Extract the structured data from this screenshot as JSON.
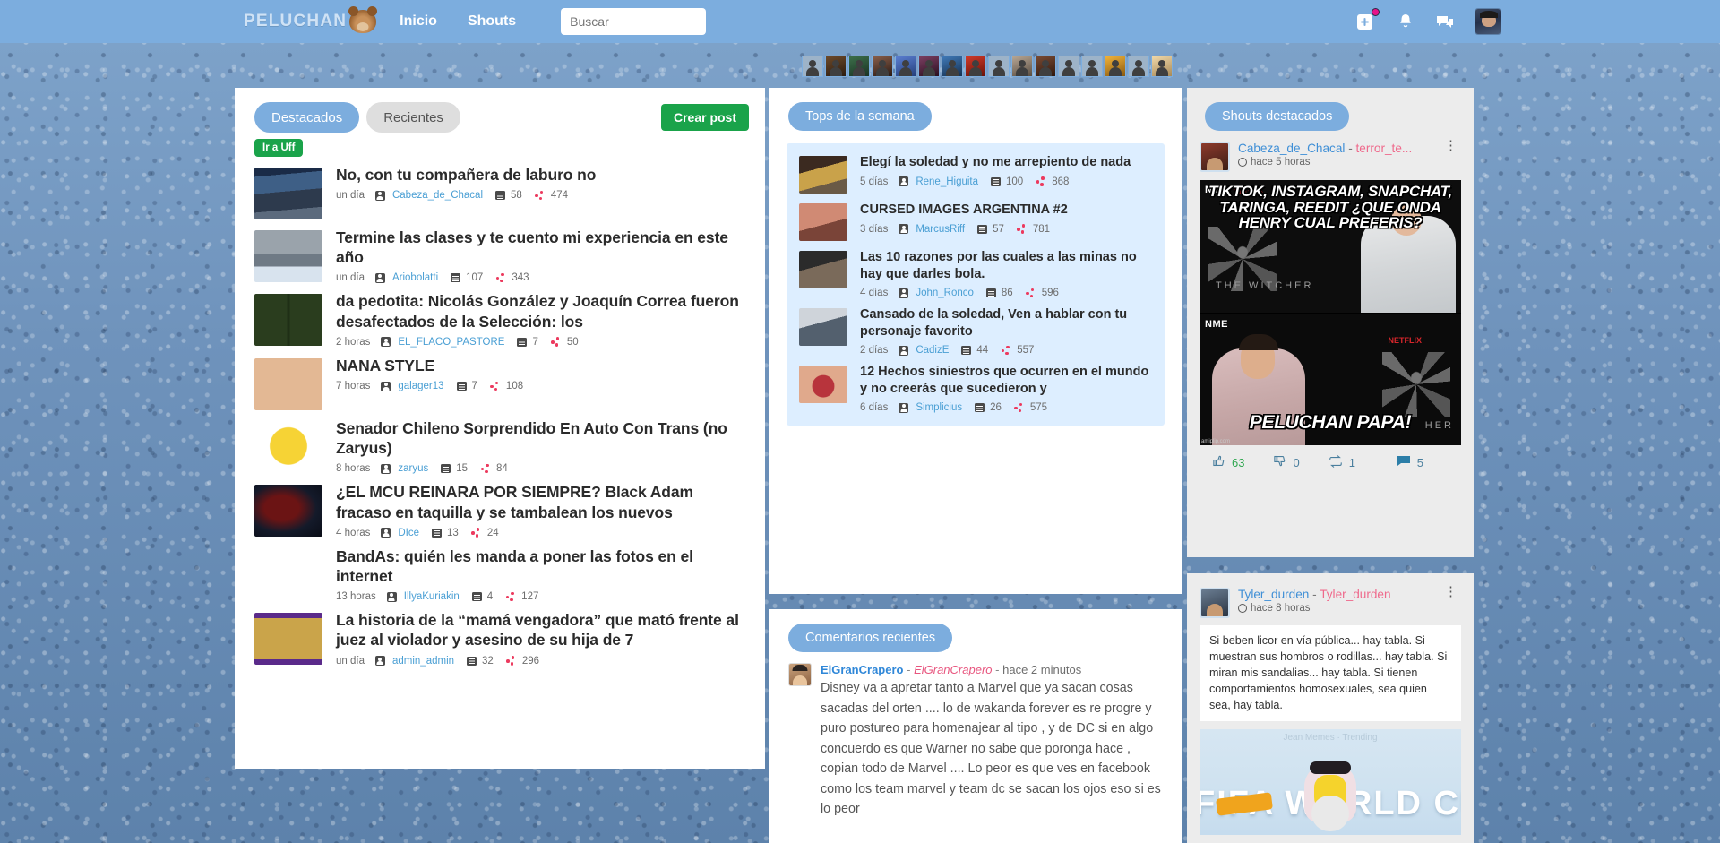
{
  "brand": {
    "name": "PELUCHAN",
    "logo_icon": "bear-icon"
  },
  "nav": {
    "links": [
      {
        "label": "Inicio",
        "name": "nav-inicio"
      },
      {
        "label": "Shouts",
        "name": "nav-shouts"
      }
    ],
    "search_placeholder": "Buscar",
    "search_value": "",
    "icons": [
      {
        "name": "add-post-icon",
        "glyph": "+",
        "badge": true
      },
      {
        "name": "notifications-bell-icon",
        "glyph": "bell"
      },
      {
        "name": "messages-icon",
        "glyph": "chat"
      }
    ],
    "avatar_name": "user-avatar"
  },
  "colors": {
    "navbar": "#7cadde",
    "accent_blue": "#7cadde",
    "green": "#1aa34a",
    "link_blue": "#4a9fd4",
    "points_red": "#ec3a5e",
    "pink": "#ef6a8c"
  },
  "left_column": {
    "tabs": [
      {
        "label": "Destacados",
        "active": true
      },
      {
        "label": "Recientes",
        "active": false
      }
    ],
    "create_post_label": "Crear post",
    "uff_label": "Ir a Uff",
    "posts": [
      {
        "title": "No, con tu compañera de laburo no",
        "time": "un día",
        "user": "Cabeza_de_Chacal",
        "comments": "58",
        "points": "474"
      },
      {
        "title": "Termine las clases y te cuento mi experiencia en este año",
        "time": "un día",
        "user": "Ariobolatti",
        "comments": "107",
        "points": "343"
      },
      {
        "title": "da pedotita: Nicolás González y Joaquín Correa fueron desafectados de la Selección: los",
        "time": "2 horas",
        "user": "EL_FLACO_PASTORE",
        "comments": "7",
        "points": "50"
      },
      {
        "title": "NANA STYLE",
        "time": "7 horas",
        "user": "galager13",
        "comments": "7",
        "points": "108"
      },
      {
        "title": "Senador Chileno Sorprendido En Auto Con Trans (no Zaryus)",
        "time": "8 horas",
        "user": "zaryus",
        "comments": "15",
        "points": "84"
      },
      {
        "title": "¿EL MCU REINARA POR SIEMPRE? Black Adam fracaso en taquilla y se tambalean los nuevos",
        "time": "4 horas",
        "user": "DIce",
        "comments": "13",
        "points": "24"
      },
      {
        "title": "BandAs: quién les manda a poner las fotos en el internet",
        "time": "13 horas",
        "user": "IllyaKuriakin",
        "comments": "4",
        "points": "127"
      },
      {
        "title": "La historia de la “mamá vengadora” que mató frente al juez al violador y asesino de su hija de 7",
        "time": "un día",
        "user": "admin_admin",
        "comments": "32",
        "points": "296"
      }
    ]
  },
  "tops": {
    "title": "Tops de la semana",
    "items": [
      {
        "title": "Elegí la soledad y no me arrepiento de nada",
        "time": "5 días",
        "user": "Rene_Higuita",
        "comments": "100",
        "points": "868"
      },
      {
        "title": "CURSED IMAGES ARGENTINA #2",
        "time": "3 días",
        "user": "MarcusRiff",
        "comments": "57",
        "points": "781"
      },
      {
        "title": "Las 10 razones por las cuales a las minas no hay que darles bola.",
        "time": "4 días",
        "user": "John_Ronco",
        "comments": "86",
        "points": "596"
      },
      {
        "title": "Cansado de la soledad, Ven a hablar con tu personaje favorito",
        "time": "2 días",
        "user": "CadizE",
        "comments": "44",
        "points": "557"
      },
      {
        "title": "12 Hechos siniestros que ocurren en el mundo y no creerás que sucedieron y",
        "time": "6 días",
        "user": "Simplicius",
        "comments": "26",
        "points": "575"
      }
    ]
  },
  "comments": {
    "title": "Comentarios recientes",
    "items": [
      {
        "user": "ElGranCrapero",
        "post": "ElGranCrapero",
        "time": "hace 2 minutos",
        "separator": "-",
        "text": "Disney va a apretar tanto a Marvel que ya sacan cosas sacadas del orten .... lo de wakanda forever es re progre y puro postureo para homenajear al tipo , y de DC si en algo concuerdo es que Warner no sabe que poronga hace , copian todo de Marvel .... Lo peor es que ves en facebook como los team marvel y team dc se sacan los ojos eso si es lo peor"
      }
    ]
  },
  "shouts": {
    "title": "Shouts destacados",
    "items": [
      {
        "user": "Cabeza_de_Chacal",
        "separator": "-",
        "tag": "terror_te...",
        "time": "hace 5 horas",
        "menu_icon": "kebab-menu-icon",
        "media_type": "meme",
        "meme": {
          "top_caption": "TIKTOK, INSTAGRAM, SNAPCHAT, TARINGA, REEDIT ¿QUE ONDA HENRY CUAL PREFERIS?",
          "bottom_caption": "PELUCHAN PAPA!",
          "brand_top": "NME",
          "brand_bottom": "NME",
          "netflix": "NETFLIX",
          "show": "THE WITCHER",
          "watermark": "amiplip.com"
        },
        "actions": {
          "likes": "63",
          "dislikes": "0",
          "reshares": "1",
          "replies": "5"
        }
      },
      {
        "user": "Tyler_durden",
        "separator": "-",
        "tag": "Tyler_durden",
        "time": "hace 8 horas",
        "menu_icon": "kebab-menu-icon",
        "media_type": "fifa",
        "text": "Si beben licor en vía pública... hay tabla. Si muestran sus hombros o rodillas... hay tabla. Si miran mis sandalias... hay tabla. Si tienen comportamientos homosexuales, sea quien sea, hay tabla.",
        "fifa": {
          "text": "FIFA WORLD CUP"
        }
      }
    ]
  }
}
